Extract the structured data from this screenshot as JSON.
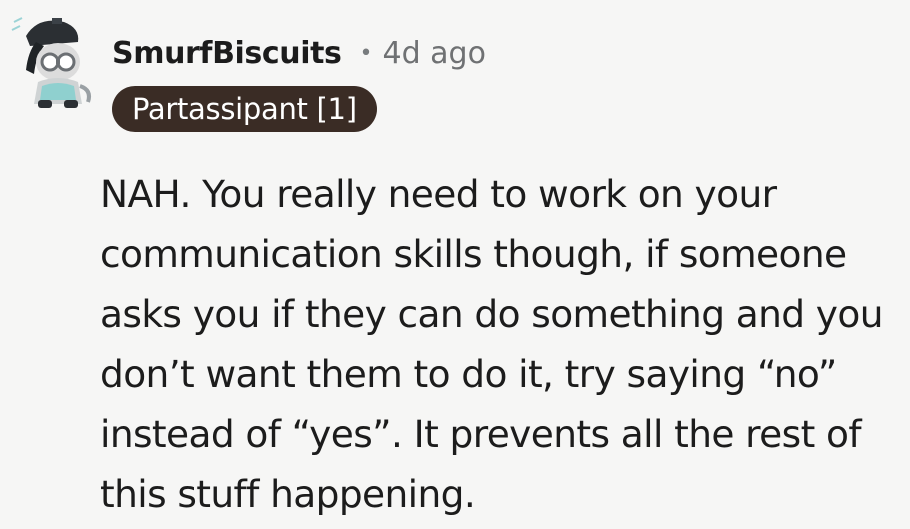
{
  "comment": {
    "author": "SmurfBiscuits",
    "separator": "•",
    "age": "4d ago",
    "flair": "Partassipant [1]",
    "avatar_icon": "snoo-avatar-icon",
    "body": "NAH. You really need to work on your communication skills though, if someone asks you if they can do something and you don’t want them to do it, try saying “no” instead of “yes”. It prevents all the rest of this stuff happening."
  },
  "colors": {
    "background": "#f6f6f5",
    "flair_background": "#3a2c25",
    "flair_text": "#ffffff",
    "meta_text": "#6f7173"
  }
}
